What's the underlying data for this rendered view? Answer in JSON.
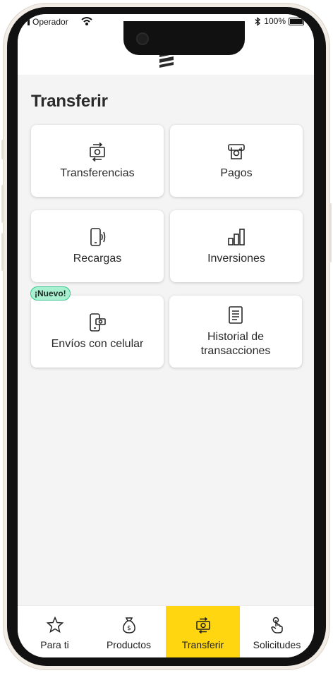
{
  "status_bar": {
    "carrier": "Operador",
    "battery": "100%"
  },
  "page": {
    "title": "Transferir"
  },
  "tiles": [
    {
      "label": "Transferencias",
      "icon": "money-transfer-icon"
    },
    {
      "label": "Pagos",
      "icon": "bill-payment-icon"
    },
    {
      "label": "Recargas",
      "icon": "phone-topup-icon"
    },
    {
      "label": "Inversiones",
      "icon": "investment-chart-icon"
    },
    {
      "label": "Envíos con celular",
      "icon": "phone-money-icon",
      "badge": "¡Nuevo!"
    },
    {
      "label": "Historial de transacciones",
      "icon": "document-history-icon"
    }
  ],
  "bottom_nav": {
    "items": [
      {
        "label": "Para ti",
        "icon": "star-icon"
      },
      {
        "label": "Productos",
        "icon": "money-bag-icon"
      },
      {
        "label": "Transferir",
        "icon": "money-transfer-icon",
        "active": true
      },
      {
        "label": "Solicitudes",
        "icon": "touch-hand-icon"
      }
    ]
  },
  "colors": {
    "accent": "#ffd60f",
    "badge_bg": "#a8f0d0",
    "badge_border": "#3cc592",
    "background": "#f4f4f4"
  }
}
